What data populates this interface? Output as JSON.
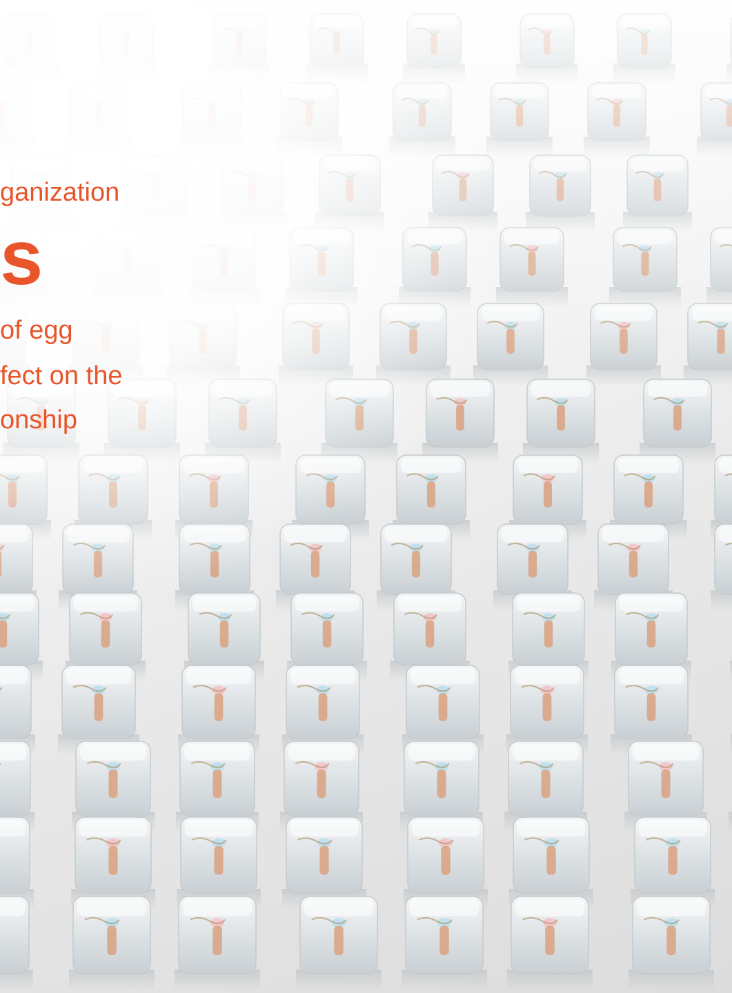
{
  "slide": {
    "heading_small": "ganization",
    "heading_large": "s",
    "body_lines": [
      "of egg",
      "fect on the",
      "onship"
    ]
  },
  "background": {
    "subject": "grid of transparent ice cubes each containing a small human embryo figure",
    "colors": {
      "accent_text": "#e8552b",
      "ice": "#dfe3e6",
      "embryo": "#d9a17f",
      "cap_blue": "#bfe0ee",
      "cap_pink": "#f1c7cc"
    }
  }
}
